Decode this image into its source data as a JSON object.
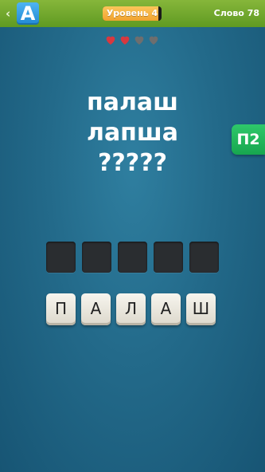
{
  "header": {
    "logo_letter": "A",
    "level_label": "Уровень 4",
    "level_progress": 0.94,
    "word_label": "Слово 78",
    "accent": "#6aa62a"
  },
  "lives": {
    "total": 4,
    "remaining": 2,
    "full_color": "#d8383f",
    "empty_color": "#6e6e6e"
  },
  "puzzle": {
    "words": [
      "палаш",
      "лапша",
      "?????"
    ]
  },
  "hint_button": {
    "label": "П2"
  },
  "answer_slots": [
    "",
    "",
    "",
    "",
    ""
  ],
  "letter_tiles": [
    "П",
    "А",
    "Л",
    "А",
    "Ш"
  ]
}
